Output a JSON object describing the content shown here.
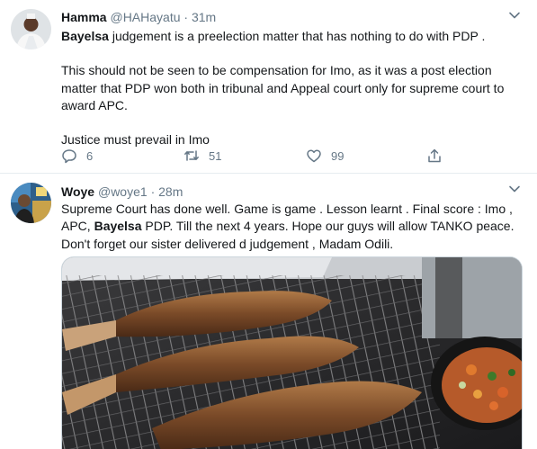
{
  "tweets": [
    {
      "name": "Hamma",
      "handle": "@HAHayatu",
      "separator": "·",
      "time": "31m",
      "text_lines": {
        "p1_bold": "Bayelsa",
        "p1_rest": " judgement is a preelection matter that has nothing to do with PDP .",
        "p2": "This should not be seen to be compensation for Imo, as it was a post election matter that PDP won both in tribunal and Appeal court only for supreme court to award APC.",
        "p3": "Justice must prevail in Imo"
      },
      "actions": {
        "reply_count": "6",
        "retweet_count": "51",
        "like_count": "99"
      },
      "icons": [
        "reply-icon",
        "retweet-icon",
        "like-icon",
        "share-icon",
        "chevron-down-icon"
      ]
    },
    {
      "name": "Woye",
      "handle": "@woye1",
      "separator": "·",
      "time": "28m",
      "text_parts": {
        "a": "Supreme Court has done well. Game is game .  Lesson learnt . Final score : Imo , APC, ",
        "bold": "Bayelsa",
        "b": " PDP. Till the next 4 years. Hope our guys will allow TANKO peace. Don't forget our sister delivered d judgement , Madam Odili."
      },
      "media_description": "grilled-fish-photo",
      "icons": [
        "chevron-down-icon"
      ]
    }
  ],
  "colors": {
    "text": "#14171a",
    "secondary": "#657786",
    "divider": "#e6ecf0"
  }
}
